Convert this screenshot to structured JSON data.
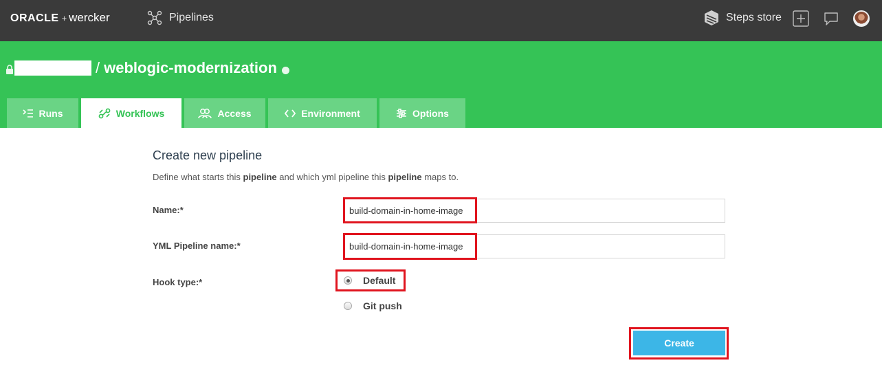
{
  "topbar": {
    "brand_oracle": "ORACLE",
    "brand_plus": "+",
    "brand_wercker": "wercker",
    "nav_pipelines": "Pipelines",
    "steps_store": "Steps store",
    "icons": [
      "pipelines-icon",
      "steps-store-icon",
      "add-icon",
      "chat-icon",
      "avatar"
    ]
  },
  "header": {
    "separator": "/",
    "repo_name": "weblogic-modernization",
    "accent_color": "#35c356"
  },
  "tabs": [
    {
      "label": "Runs",
      "icon": "runs-icon",
      "active": false
    },
    {
      "label": "Workflows",
      "icon": "workflows-icon",
      "active": true
    },
    {
      "label": "Access",
      "icon": "access-icon",
      "active": false
    },
    {
      "label": "Environment",
      "icon": "code-icon",
      "active": false
    },
    {
      "label": "Options",
      "icon": "options-icon",
      "active": false
    }
  ],
  "form": {
    "title": "Create new pipeline",
    "desc_part1": "Define what starts this ",
    "desc_bold1": "pipeline",
    "desc_part2": " and which yml pipeline this ",
    "desc_bold2": "pipeline",
    "desc_part3": " maps to.",
    "name_label": "Name:*",
    "name_value": "build-domain-in-home-image",
    "yml_label": "YML Pipeline name:*",
    "yml_value": "build-domain-in-home-image",
    "hook_label": "Hook type:*",
    "hook_options": [
      {
        "label": "Default",
        "selected": true
      },
      {
        "label": "Git push",
        "selected": false
      }
    ],
    "create_label": "Create",
    "button_color": "#3cb6e7",
    "highlight_color": "#e0141e"
  }
}
